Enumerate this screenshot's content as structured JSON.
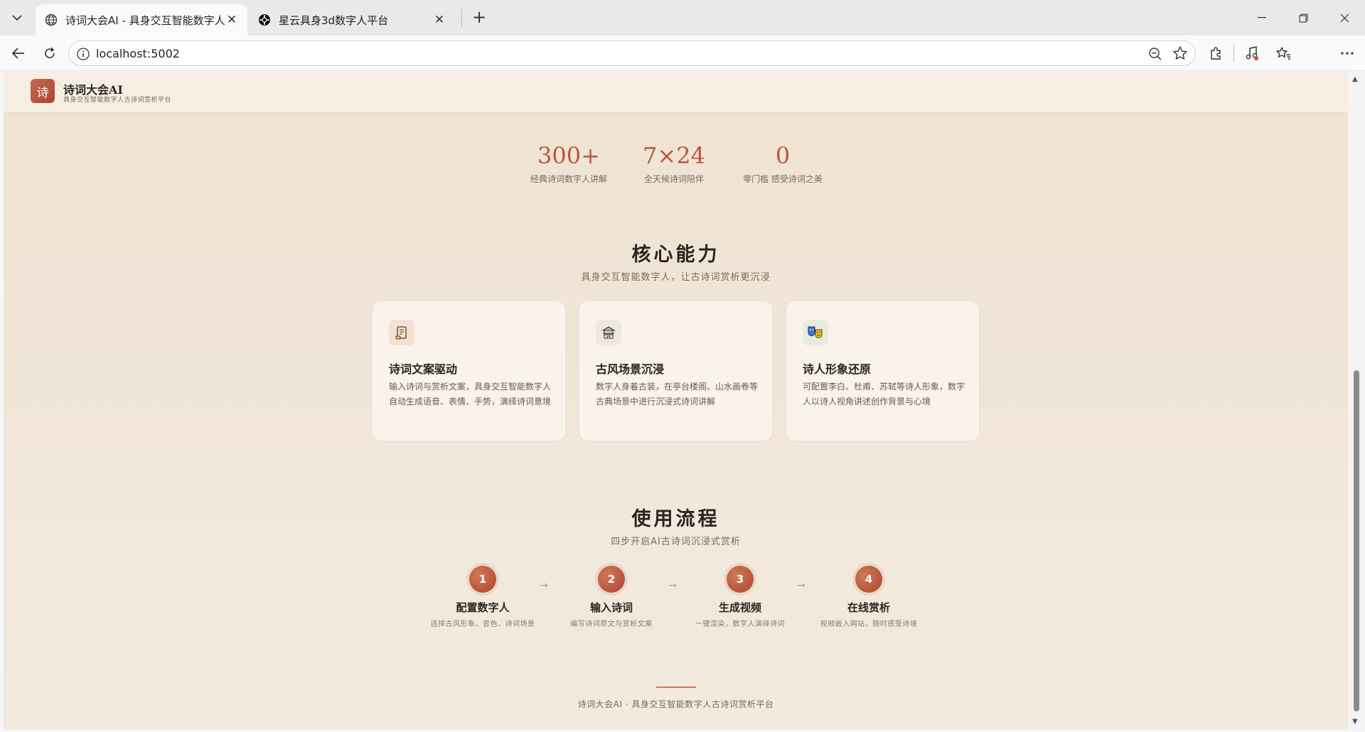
{
  "browser": {
    "tabs": [
      {
        "title": "诗词大会AI - 具身交互智能数字人古",
        "active": true,
        "icon": "globe-icon"
      },
      {
        "title": "星云具身3d数字人平台",
        "active": false,
        "icon": "cube-icon"
      }
    ],
    "url": "localhost:5002"
  },
  "site": {
    "logo_char": "诗",
    "title": "诗词大会AI",
    "subtitle": "具身交互智能数字人古诗词赏析平台"
  },
  "stats": [
    {
      "value": "300+",
      "label": "经典诗词数字人讲解"
    },
    {
      "value": "7×24",
      "label": "全天候诗词陪伴"
    },
    {
      "value": "0",
      "label": "零门槛 感受诗词之美"
    }
  ],
  "capabilities": {
    "title": "核心能力",
    "subtitle": "具身交互智能数字人，让古诗词赏析更沉浸",
    "cards": [
      {
        "icon": "scroll-icon",
        "glyph": "📜",
        "title": "诗词文案驱动",
        "desc": "输入诗词与赏析文案，具身交互智能数字人自动生成语音、表情、手势，演绎诗词意境"
      },
      {
        "icon": "pagoda-icon",
        "glyph": "🏯",
        "title": "古风场景沉浸",
        "desc": "数字人身着古装，在亭台楼阁、山水画卷等古典场景中进行沉浸式诗词讲解"
      },
      {
        "icon": "theater-masks-icon",
        "glyph": "🎭",
        "title": "诗人形象还原",
        "desc": "可配置李白、杜甫、苏轼等诗人形象，数字人以诗人视角讲述创作背景与心境"
      }
    ]
  },
  "workflow": {
    "title": "使用流程",
    "subtitle": "四步开启AI古诗词沉浸式赏析",
    "arrow": "→",
    "steps": [
      {
        "num": "1",
        "title": "配置数字人",
        "desc": "选择古风形象、音色、诗词场景"
      },
      {
        "num": "2",
        "title": "输入诗词",
        "desc": "编写诗词原文与赏析文案"
      },
      {
        "num": "3",
        "title": "生成视频",
        "desc": "一键渲染，数字人演绎诗词"
      },
      {
        "num": "4",
        "title": "在线赏析",
        "desc": "视频嵌入网站，随时感受诗境"
      }
    ]
  },
  "footer": {
    "text": "诗词大会AI · 具身交互智能数字人古诗词赏析平台"
  },
  "colors": {
    "accent": "#b8573e",
    "page_bg": "#f0e5d7",
    "card_bg": "#f9f3eb"
  }
}
